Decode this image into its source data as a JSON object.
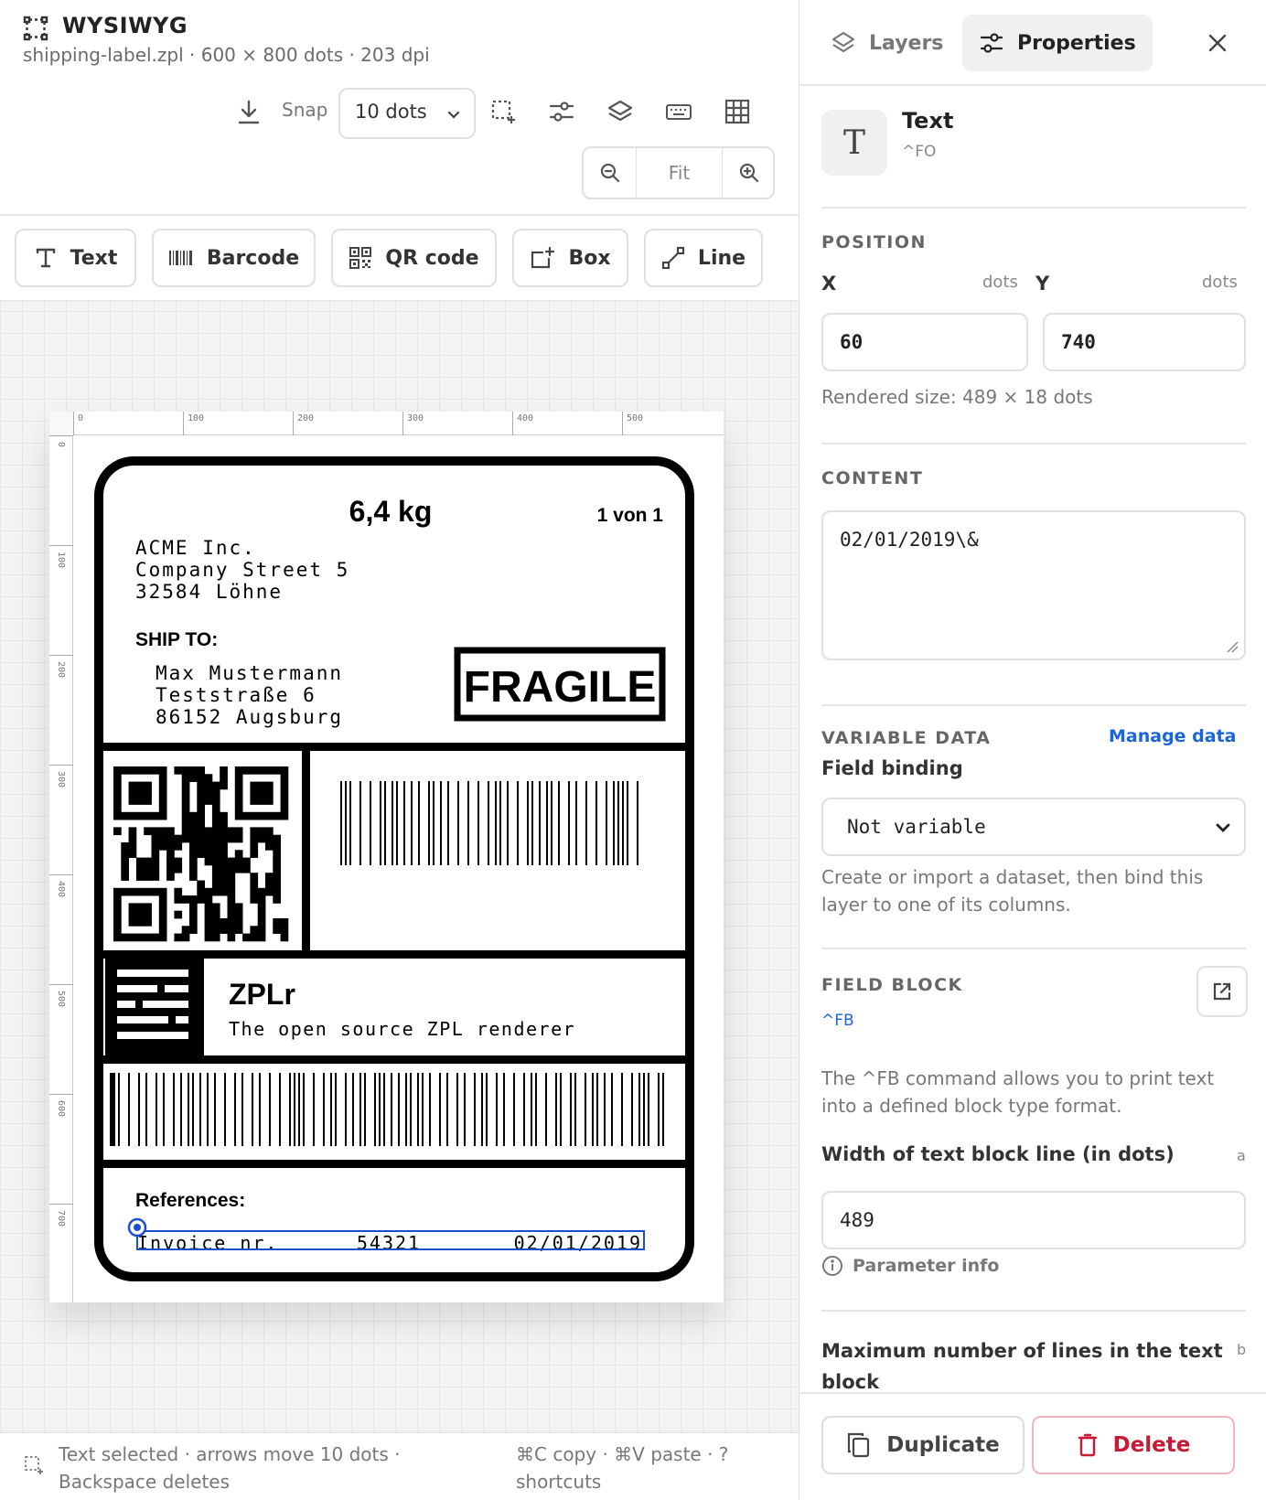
{
  "header": {
    "title": "WYSIWYG",
    "file_info": "shipping-label.zpl · 600 × 800 dots · 203 dpi",
    "snap_label": "Snap",
    "snap_value": "10 dots",
    "zoom_fit": "Fit"
  },
  "elements": [
    {
      "label": "Text",
      "icon": "text-icon"
    },
    {
      "label": "Barcode",
      "icon": "barcode-icon"
    },
    {
      "label": "QR code",
      "icon": "qr-icon"
    },
    {
      "label": "Box",
      "icon": "box-icon"
    },
    {
      "label": "Line",
      "icon": "line-icon"
    }
  ],
  "rulers": {
    "horizontal": [
      "0",
      "100",
      "200",
      "300",
      "400",
      "500"
    ],
    "vertical": [
      "0",
      "100",
      "200",
      "300",
      "400",
      "500",
      "600",
      "700"
    ]
  },
  "label": {
    "weight": "6,4 kg",
    "pages": "1 von 1",
    "sender": [
      "ACME Inc.",
      "Company Street 5",
      "32584 Löhne"
    ],
    "ship_to": "SHIP TO:",
    "recipient": [
      "Max Mustermann",
      "Teststraße 6",
      "86152 Augsburg"
    ],
    "fragile": "FRAGILE",
    "brand": "ZPLr",
    "tagline": "The open source ZPL renderer",
    "references": "References:",
    "invoice_label": "Invoice nr.",
    "invoice_no": "54321",
    "invoice_date": "02/01/2019"
  },
  "status": {
    "left": "Text selected · arrows move 10 dots · Backspace deletes",
    "right": "⌘C copy · ⌘V paste · ? shortcuts"
  },
  "panel": {
    "tab_layers": "Layers",
    "tab_properties": "Properties",
    "type_name": "Text",
    "type_cmd": "^FO",
    "position_heading": "POSITION",
    "x_label": "X",
    "y_label": "Y",
    "unit": "dots",
    "x_value": "60",
    "y_value": "740",
    "rendered_size": "Rendered size: 489 × 18 dots",
    "content_heading": "CONTENT",
    "content_value": "02/01/2019\\&",
    "variable_heading": "VARIABLE DATA",
    "manage_data": "Manage data",
    "field_binding_label": "Field binding",
    "field_binding_value": "Not variable",
    "variable_hint": "Create or import a dataset, then bind this layer to one of its columns.",
    "field_block_heading": "FIELD BLOCK",
    "field_block_cmd": "^FB",
    "field_block_desc": "The ^FB command allows you to print text into a defined block type format.",
    "width_label": "Width of text block line (in dots)",
    "width_param": "a",
    "width_value": "489",
    "param_info": "Parameter info",
    "maxlines_label": "Maximum number of lines in the text block",
    "maxlines_param": "b",
    "duplicate": "Duplicate",
    "delete": "Delete"
  },
  "colors": {
    "accent": "#1a66d9",
    "danger": "#c81a34",
    "selection": "#1a4fd0"
  }
}
